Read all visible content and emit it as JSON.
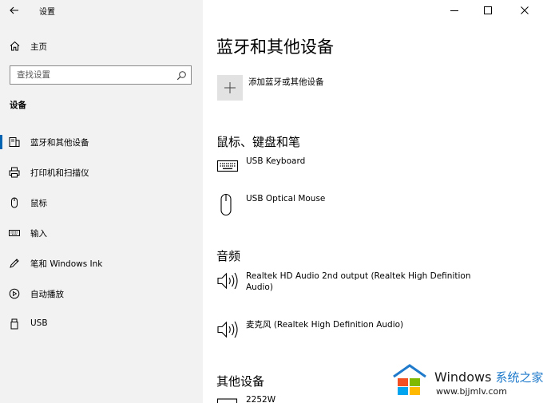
{
  "window": {
    "app_title": "设置"
  },
  "nav": {
    "home_label": "主页",
    "search_placeholder": "查找设置",
    "section_heading": "设备",
    "items": [
      {
        "label": "蓝牙和其他设备",
        "selected": true,
        "icon": "bluetooth-devices-icon"
      },
      {
        "label": "打印机和扫描仪",
        "selected": false,
        "icon": "printer-icon"
      },
      {
        "label": "鼠标",
        "selected": false,
        "icon": "mouse-icon"
      },
      {
        "label": "输入",
        "selected": false,
        "icon": "keyboard-icon"
      },
      {
        "label": "笔和 Windows Ink",
        "selected": false,
        "icon": "pen-icon"
      },
      {
        "label": "自动播放",
        "selected": false,
        "icon": "autoplay-icon"
      },
      {
        "label": "USB",
        "selected": false,
        "icon": "usb-icon"
      }
    ],
    "accent_color": "#0063b1"
  },
  "main": {
    "title": "蓝牙和其他设备",
    "add_device_label": "添加蓝牙或其他设备",
    "groups": {
      "input": {
        "title": "鼠标、键盘和笔",
        "devices": [
          "USB Keyboard",
          "USB Optical Mouse"
        ]
      },
      "audio": {
        "title": "音频",
        "devices": [
          "Realtek HD Audio 2nd output (Realtek High Definition Audio)",
          "麦克风 (Realtek High Definition Audio)"
        ]
      },
      "other": {
        "title": "其他设备",
        "devices": [
          "2252W"
        ]
      }
    }
  },
  "watermark": {
    "brand": "Windows",
    "site_name": "系统之家",
    "url": "www.bjjmlv.com"
  }
}
